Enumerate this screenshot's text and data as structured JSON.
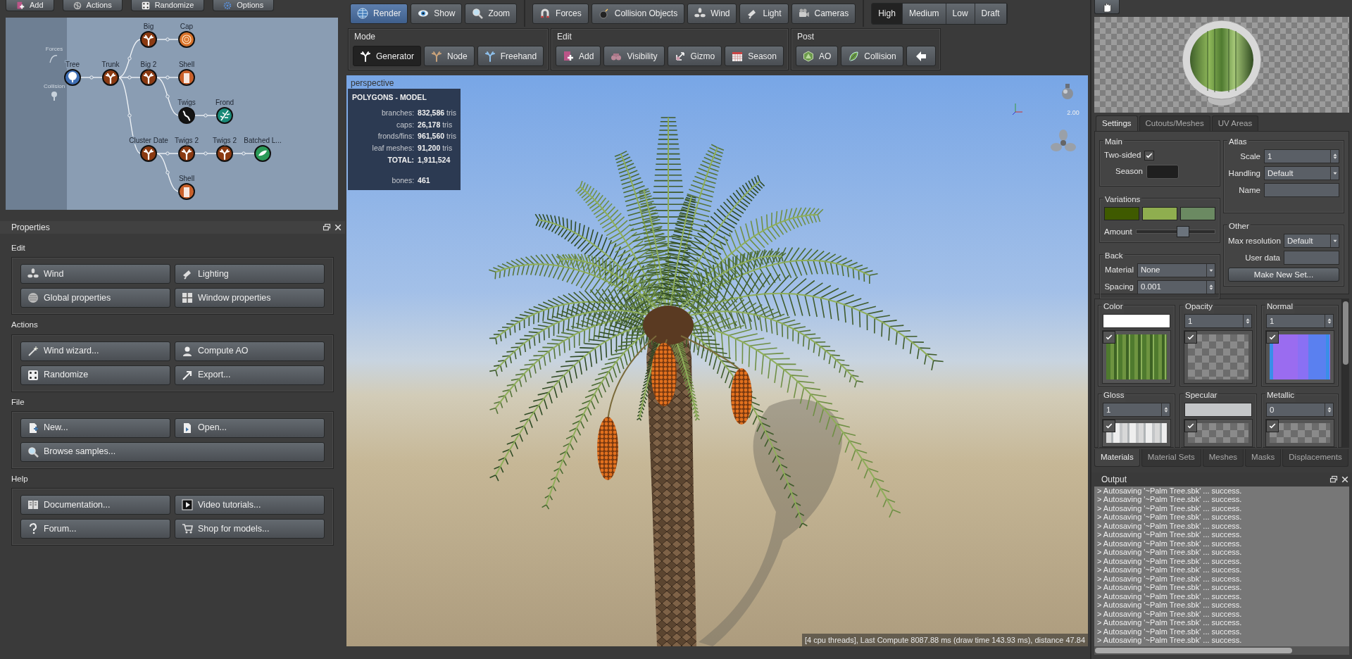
{
  "left_toolbar": [
    {
      "label": "Add"
    },
    {
      "label": "Actions"
    },
    {
      "label": "Randomize"
    },
    {
      "label": "Options"
    }
  ],
  "graph": {
    "side_items": [
      {
        "label": "Forces"
      },
      {
        "label": "Collision"
      }
    ],
    "nodes": [
      {
        "label": "Tree",
        "kind": "tree",
        "children": [
          {
            "label": "Trunk",
            "kind": "branch",
            "children": [
              {
                "label": "Big",
                "kind": "branch",
                "children": [
                  {
                    "label": "Cap",
                    "kind": "cap"
                  }
                ]
              },
              {
                "label": "Big 2",
                "kind": "branch",
                "children": [
                  {
                    "label": "Shell",
                    "kind": "shell"
                  },
                  {
                    "label": "Twigs",
                    "kind": "twig",
                    "children": [
                      {
                        "label": "Frond",
                        "kind": "frond"
                      }
                    ]
                  }
                ]
              },
              {
                "label": "Cluster Date",
                "kind": "branch",
                "children": [
                  {
                    "label": "Twigs 2",
                    "kind": "branch",
                    "children": [
                      {
                        "label": "Twigs 2",
                        "kind": "branch",
                        "children": [
                          {
                            "label": "Batched L...",
                            "kind": "leaf"
                          }
                        ]
                      }
                    ]
                  },
                  {
                    "label": "Shell",
                    "kind": "shell"
                  }
                ]
              }
            ]
          }
        ]
      }
    ]
  },
  "properties": {
    "title": "Properties",
    "groups": [
      {
        "title": "Edit",
        "buttons": [
          {
            "label": "Wind"
          },
          {
            "label": "Lighting"
          },
          {
            "label": "Global properties"
          },
          {
            "label": "Window properties"
          }
        ]
      },
      {
        "title": "Actions",
        "buttons": [
          {
            "label": "Wind wizard..."
          },
          {
            "label": "Compute AO"
          },
          {
            "label": "Randomize"
          },
          {
            "label": "Export..."
          }
        ]
      },
      {
        "title": "File",
        "buttons": [
          {
            "label": "New..."
          },
          {
            "label": "Open..."
          },
          {
            "label": "Browse samples...",
            "wide": true
          }
        ]
      },
      {
        "title": "Help",
        "buttons": [
          {
            "label": "Documentation..."
          },
          {
            "label": "Video tutorials..."
          },
          {
            "label": "Forum..."
          },
          {
            "label": "Shop for models..."
          }
        ]
      }
    ]
  },
  "view_tools": [
    {
      "label": "Render",
      "selected": true
    },
    {
      "label": "Show",
      "selected": false
    },
    {
      "label": "Zoom",
      "selected": false
    }
  ],
  "scene_tools": [
    {
      "label": "Forces"
    },
    {
      "label": "Collision Objects"
    },
    {
      "label": "Wind"
    },
    {
      "label": "Light"
    },
    {
      "label": "Cameras"
    }
  ],
  "quality": [
    {
      "label": "High",
      "selected": true
    },
    {
      "label": "Medium",
      "selected": false
    },
    {
      "label": "Low",
      "selected": false
    },
    {
      "label": "Draft",
      "selected": false
    }
  ],
  "mode": {
    "title": "Mode",
    "items": [
      {
        "label": "Generator",
        "selected": true
      },
      {
        "label": "Node",
        "selected": false
      },
      {
        "label": "Freehand",
        "selected": false
      }
    ]
  },
  "edit": {
    "title": "Edit",
    "items": [
      {
        "label": "Add"
      },
      {
        "label": "Visibility"
      },
      {
        "label": "Gizmo"
      },
      {
        "label": "Season"
      }
    ]
  },
  "post": {
    "title": "Post",
    "items": [
      {
        "label": "AO"
      },
      {
        "label": "Collision"
      }
    ]
  },
  "viewport": {
    "label": "perspective",
    "zoom_reading": "2.00",
    "status": "[4 cpu threads], Last Compute 8087.88 ms (draw time 143.93 ms), distance 47.84",
    "stats": {
      "title": "POLYGONS - MODEL",
      "rows": [
        {
          "kind": "tris",
          "label": "branches:",
          "value": "832,586",
          "unit": "tris"
        },
        {
          "kind": "tris",
          "label": "caps:",
          "value": "26,178",
          "unit": "tris"
        },
        {
          "kind": "tris",
          "label": "fronds/fins:",
          "value": "961,560",
          "unit": "tris"
        },
        {
          "kind": "tris",
          "label": "leaf meshes:",
          "value": "91,200",
          "unit": "tris"
        },
        {
          "kind": "total",
          "label": "TOTAL:",
          "value": "1,911,524"
        },
        {
          "kind": "bones",
          "label": "bones:",
          "value": "461"
        }
      ]
    }
  },
  "material_tabs": [
    {
      "label": "Settings",
      "selected": true
    },
    {
      "label": "Cutouts/Meshes",
      "selected": false
    },
    {
      "label": "UV Areas",
      "selected": false
    }
  ],
  "main": {
    "title": "Main",
    "two_sided": {
      "label": "Two-sided",
      "checked": true
    },
    "season": {
      "label": "Season"
    }
  },
  "variations": {
    "title": "Variations",
    "swatches": [
      {
        "color": "#3f5a00"
      },
      {
        "color": "#8fae4f"
      },
      {
        "color": "#6b8a62"
      }
    ],
    "amount": {
      "label": "Amount",
      "level": 0.6
    }
  },
  "back": {
    "title": "Back",
    "material": {
      "label": "Material",
      "value": "None"
    },
    "spacing": {
      "label": "Spacing",
      "value": "0.001"
    }
  },
  "atlas": {
    "title": "Atlas",
    "scale": {
      "label": "Scale",
      "value": "1"
    },
    "handling": {
      "label": "Handling",
      "value": "Default"
    },
    "name": {
      "label": "Name"
    }
  },
  "other": {
    "title": "Other",
    "max_resolution": {
      "label": "Max resolution",
      "value": "Default"
    },
    "user_data": {
      "label": "User data"
    },
    "button": "Make New Set..."
  },
  "maps": [
    {
      "label": "Color",
      "kind": "swatch",
      "color": "#ffffff",
      "checked": true,
      "texture": {
        "kind": "diffuse"
      }
    },
    {
      "label": "Opacity",
      "kind": "number",
      "value": "1",
      "checked": true,
      "texture": {
        "kind": "empty"
      }
    },
    {
      "label": "Normal",
      "kind": "number",
      "value": "1",
      "checked": true,
      "texture": {
        "kind": "normal"
      }
    },
    {
      "label": "Gloss",
      "kind": "number",
      "value": "1",
      "checked": true,
      "texture": {
        "kind": "gloss"
      }
    },
    {
      "label": "Specular",
      "kind": "swatch",
      "color": "#c4c6c8",
      "checked": true,
      "texture": {
        "kind": "empty"
      }
    },
    {
      "label": "Metallic",
      "kind": "number",
      "value": "0",
      "checked": true,
      "texture": {
        "kind": "empty"
      }
    }
  ],
  "bottom_tabs": [
    {
      "label": "Materials",
      "selected": true
    },
    {
      "label": "Material Sets",
      "selected": false
    },
    {
      "label": "Meshes",
      "selected": false
    },
    {
      "label": "Masks",
      "selected": false
    },
    {
      "label": "Displacements",
      "selected": false
    }
  ],
  "output": {
    "title": "Output",
    "lines": [
      "> Autosaving '~Palm Tree.sbk' ... success.",
      "> Autosaving '~Palm Tree.sbk' ... success.",
      "> Autosaving '~Palm Tree.sbk' ... success.",
      "> Autosaving '~Palm Tree.sbk' ... success.",
      "> Autosaving '~Palm Tree.sbk' ... success.",
      "> Autosaving '~Palm Tree.sbk' ... success.",
      "> Autosaving '~Palm Tree.sbk' ... success.",
      "> Autosaving '~Palm Tree.sbk' ... success.",
      "> Autosaving '~Palm Tree.sbk' ... success.",
      "> Autosaving '~Palm Tree.sbk' ... success.",
      "> Autosaving '~Palm Tree.sbk' ... success.",
      "> Autosaving '~Palm Tree.sbk' ... success.",
      "> Autosaving '~Palm Tree.sbk' ... success.",
      "> Autosaving '~Palm Tree.sbk' ... success.",
      "> Autosaving '~Palm Tree.sbk' ... success.",
      "> Autosaving '~Palm Tree.sbk' ... success.",
      "> Autosaving '~Palm Tree.sbk' ... success.",
      "> Autosaving '~Palm Tree.sbk' ... success."
    ]
  }
}
